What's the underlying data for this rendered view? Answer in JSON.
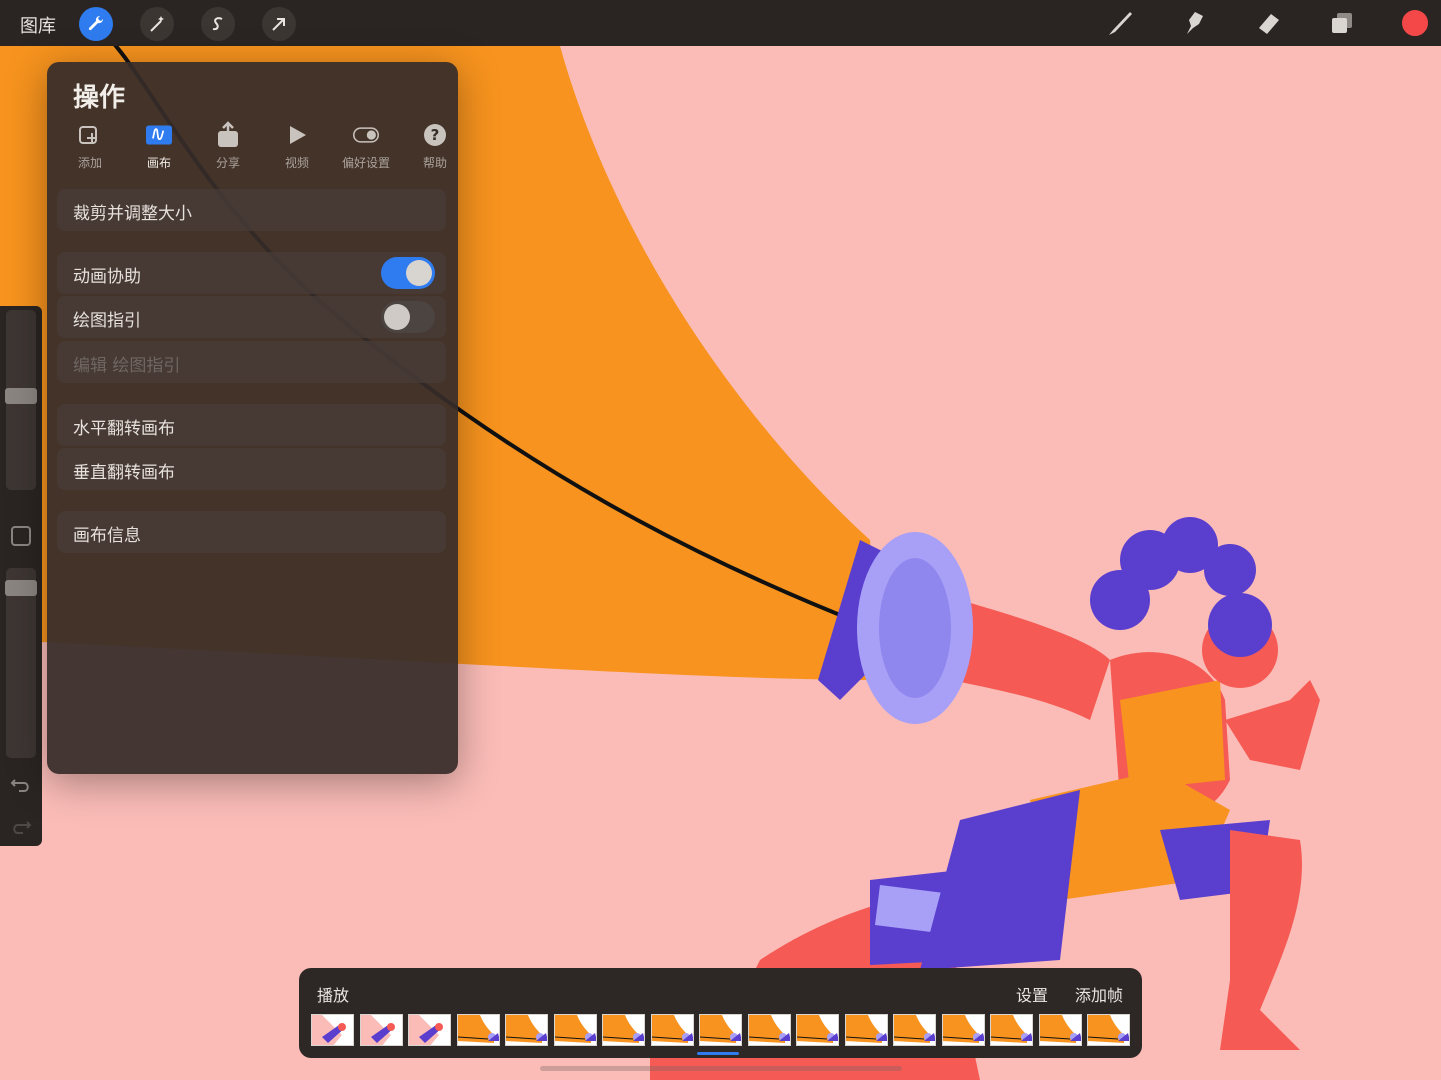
{
  "topbar": {
    "gallery_label": "图库",
    "left_tools": [
      {
        "name": "actions-wrench-icon",
        "active": true
      },
      {
        "name": "adjustments-wand-icon",
        "active": false
      },
      {
        "name": "selection-icon",
        "active": false
      },
      {
        "name": "transform-arrow-icon",
        "active": false
      }
    ],
    "right_tools": [
      "brush-icon",
      "smudge-icon",
      "eraser-icon",
      "layers-icon"
    ],
    "current_color": "#f44848"
  },
  "actions_panel": {
    "title": "操作",
    "tabs": [
      {
        "label": "添加",
        "icon": "add-image-icon",
        "active": false
      },
      {
        "label": "画布",
        "icon": "canvas-icon",
        "active": true
      },
      {
        "label": "分享",
        "icon": "share-icon",
        "active": false
      },
      {
        "label": "视频",
        "icon": "video-play-icon",
        "active": false
      },
      {
        "label": "偏好设置",
        "icon": "preferences-toggle-icon",
        "active": false
      },
      {
        "label": "帮助",
        "icon": "help-icon",
        "active": false
      }
    ],
    "rows": {
      "crop_resize": "裁剪并调整大小",
      "animation_assist": "动画协助",
      "animation_assist_on": true,
      "drawing_guide": "绘图指引",
      "drawing_guide_on": false,
      "edit_drawing_guide": "编辑 绘图指引",
      "flip_horizontal": "水平翻转画布",
      "flip_vertical": "垂直翻转画布",
      "canvas_info": "画布信息"
    }
  },
  "animation_bar": {
    "play_label": "播放",
    "settings_label": "设置",
    "add_frame_label": "添加帧",
    "frame_count": 17,
    "selected_frame_index": 8
  },
  "colors": {
    "accent": "#2f7cf0",
    "canvas_background": "#fbbcb7",
    "orange": "#f7931e",
    "purple": "#5a3fcf",
    "lavender": "#a8a0f7",
    "skin": "#f55a55"
  }
}
